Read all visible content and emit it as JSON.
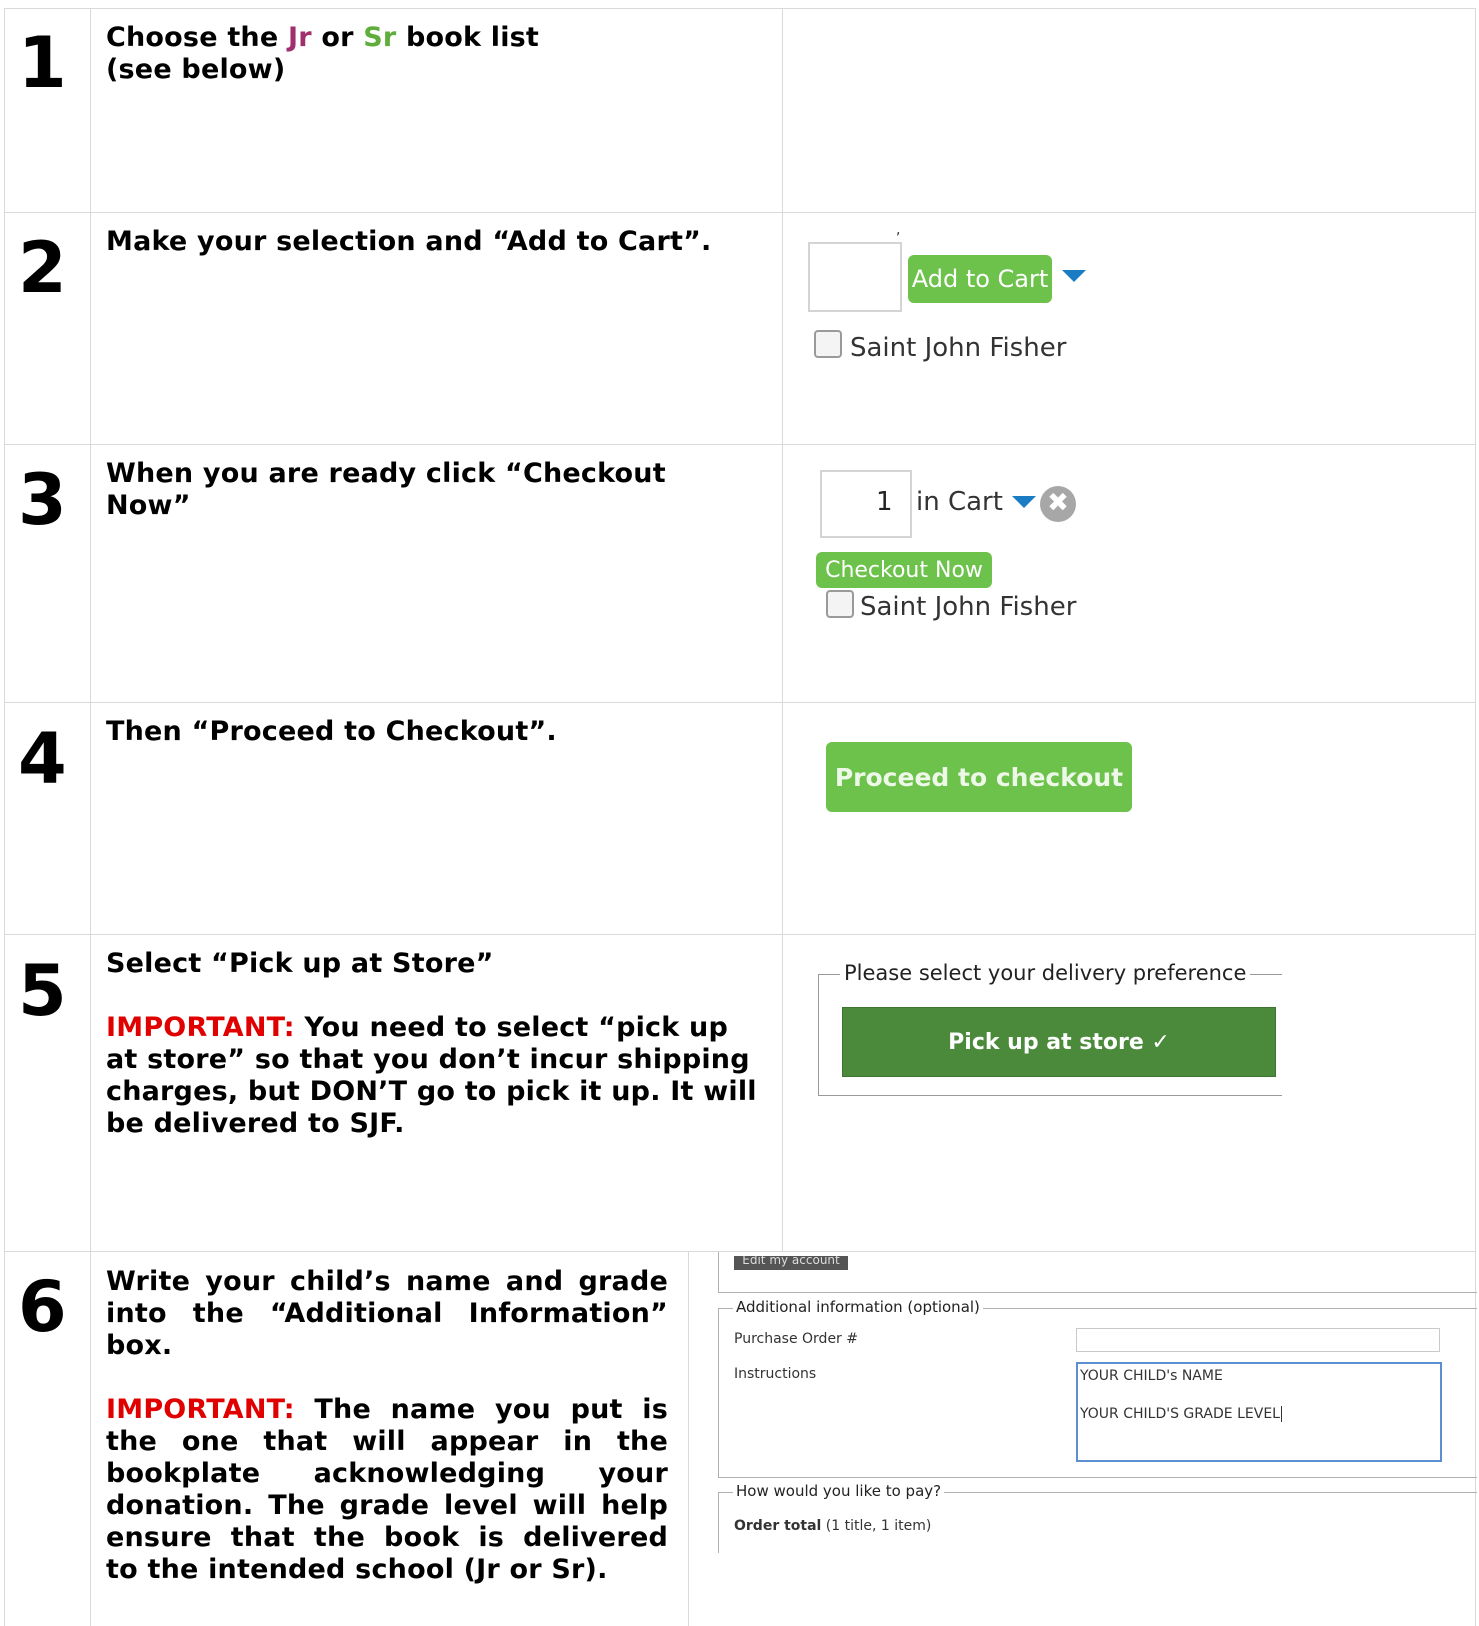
{
  "steps": [
    {
      "number": "1",
      "instruction": {
        "part1": "Choose the ",
        "jr": "Jr",
        "part2": " or ",
        "sr": "Sr",
        "part3": " book list",
        "line2": "(see below)"
      }
    },
    {
      "number": "2",
      "instruction": "Make your selection and “Add to Cart”.",
      "ui": {
        "add_to_cart_label": "Add to Cart",
        "checkbox_label": "Saint John Fisher",
        "tick": ","
      }
    },
    {
      "number": "3",
      "instruction_line1": "When you are ready click “Checkout",
      "instruction_line2": "Now”",
      "ui": {
        "quantity": "1",
        "in_cart_label": "in Cart",
        "remove_glyph": "✖",
        "checkout_now_label": "Checkout Now",
        "checkbox_label": "Saint John Fisher"
      }
    },
    {
      "number": "4",
      "instruction": "Then “Proceed to Checkout”.",
      "ui": {
        "proceed_label": "Proceed to checkout"
      }
    },
    {
      "number": "5",
      "instruction": "Select “Pick up at Store”",
      "important_label": "IMPORTANT:",
      "important_text_lines": [
        " You need to select “pick up",
        "at store” so that you don’t incur shipping",
        "charges, but DON’T go to pick it up. It will",
        "be delivered to SJF."
      ],
      "ui": {
        "legend": "Please select your delivery preference",
        "pickup_label": "Pick up at store ✓"
      }
    },
    {
      "number": "6",
      "instruction_lines": [
        "Write your child’s name and grade",
        "into the “Additional Information”",
        "box."
      ],
      "important_label": "IMPORTANT:",
      "important_text_lines": [
        " The name you put is",
        "the one that will appear  in the",
        "bookplate  acknowledging  your",
        "donation. The grade level will help",
        "ensure that the book is delivered",
        "to the intended school (Jr or Sr)."
      ],
      "ui": {
        "edit_account_label": "Edit my account",
        "additional_legend": "Additional information (optional)",
        "purchase_order_label": "Purchase Order #",
        "instructions_label": "Instructions",
        "textarea_line1": "YOUR CHILD's NAME",
        "textarea_line2": "YOUR CHILD'S GRADE LEVEL",
        "pay_legend": "How would you like to pay?",
        "order_total_label": "Order total",
        "order_total_detail": " (1 title, 1 item)"
      }
    }
  ],
  "colors": {
    "jr": "#a0306d",
    "sr": "#5fae3b",
    "important": "#e00000",
    "green_button": "#6cc24a",
    "dark_green_button": "#4a8a3a",
    "arrow_blue": "#1a7dc4"
  }
}
